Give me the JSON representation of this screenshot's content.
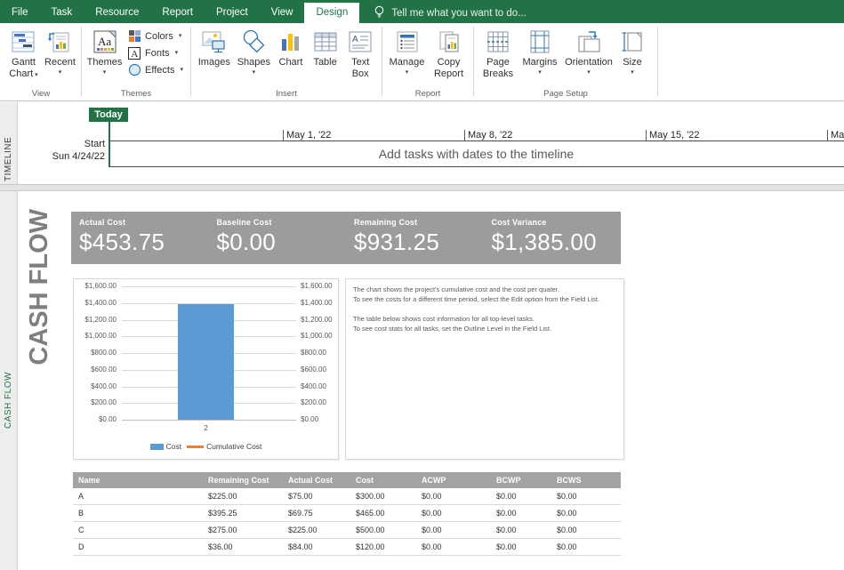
{
  "colors": {
    "accent_green": "#217346",
    "metric_band_gray": "#9c9c9c",
    "table_header_gray": "#a3a3a3",
    "bar_blue": "#5b9bd5",
    "line_orange": "#ed7d31"
  },
  "ribbon": {
    "tabs": [
      "File",
      "Task",
      "Resource",
      "Report",
      "Project",
      "View",
      "Design"
    ],
    "active_tab": "Design",
    "tell_me": "Tell me what you want to do...",
    "groups": [
      {
        "label": "View",
        "buttons": [
          {
            "label": "Gantt Chart"
          },
          {
            "label": "Recent"
          }
        ]
      },
      {
        "label": "Themes",
        "buttons": [
          {
            "label": "Themes"
          },
          {
            "label": "Colors"
          },
          {
            "label": "Fonts"
          },
          {
            "label": "Effects"
          }
        ]
      },
      {
        "label": "Insert",
        "buttons": [
          {
            "label": "Images"
          },
          {
            "label": "Shapes"
          },
          {
            "label": "Chart"
          },
          {
            "label": "Table"
          },
          {
            "label": "Text Box"
          }
        ]
      },
      {
        "label": "Report",
        "buttons": [
          {
            "label": "Manage"
          },
          {
            "label": "Copy Report"
          }
        ]
      },
      {
        "label": "Page Setup",
        "buttons": [
          {
            "label": "Page Breaks"
          },
          {
            "label": "Margins"
          },
          {
            "label": "Orientation"
          },
          {
            "label": "Size"
          }
        ]
      }
    ]
  },
  "timeline": {
    "pane_label": "TIMELINE",
    "today_label": "Today",
    "start_label": "Start",
    "start_date": "Sun 4/24/22",
    "dates": [
      "May 1, '22",
      "May 8, '22",
      "May 15, '22",
      "Ma"
    ],
    "placeholder": "Add tasks with dates to the timeline"
  },
  "report": {
    "pane_label": "CASH FLOW",
    "title": "CASH FLOW",
    "metrics": [
      {
        "label": "Actual Cost",
        "value": "$453.75"
      },
      {
        "label": "Baseline Cost",
        "value": "$0.00"
      },
      {
        "label": "Remaining Cost",
        "value": "$931.25"
      },
      {
        "label": "Cost Variance",
        "value": "$1,385.00"
      }
    ],
    "description_lines": [
      "The chart shows the project's cumulative cost and the cost per quater.",
      "To see the costs for a different time period, select the Edit option from the Field List.",
      "The table below shows cost information for all top-level tasks.",
      "To see cost stats for all tasks, set the Outline Level in the Field List."
    ],
    "table": {
      "headers": [
        "Name",
        "Remaining Cost",
        "Actual Cost",
        "Cost",
        "ACWP",
        "BCWP",
        "BCWS"
      ],
      "rows": [
        [
          "A",
          "$225.00",
          "$75.00",
          "$300.00",
          "$0.00",
          "$0.00",
          "$0.00"
        ],
        [
          "B",
          "$395.25",
          "$69.75",
          "$465.00",
          "$0.00",
          "$0.00",
          "$0.00"
        ],
        [
          "C",
          "$275.00",
          "$225.00",
          "$500.00",
          "$0.00",
          "$0.00",
          "$0.00"
        ],
        [
          "D",
          "$36.00",
          "$84.00",
          "$120.00",
          "$0.00",
          "$0.00",
          "$0.00"
        ]
      ]
    }
  },
  "chart_data": {
    "type": "bar",
    "title": "",
    "categories": [
      "2"
    ],
    "series": [
      {
        "name": "Cost",
        "type": "bar",
        "color": "#5b9bd5",
        "values": [
          1385
        ]
      },
      {
        "name": "Cumulative Cost",
        "type": "line",
        "color": "#ed7d31",
        "values": []
      }
    ],
    "xlabel": "",
    "ylabel": "",
    "ylim": [
      0,
      1600
    ],
    "ytick_step": 200,
    "ytick_labels": [
      "$0.00",
      "$200.00",
      "$400.00",
      "$600.00",
      "$800.00",
      "$1,000.00",
      "$1,200.00",
      "$1,400.00",
      "$1,600.00"
    ],
    "grid": true,
    "legend_position": "bottom",
    "dual_axis_labels": true
  }
}
